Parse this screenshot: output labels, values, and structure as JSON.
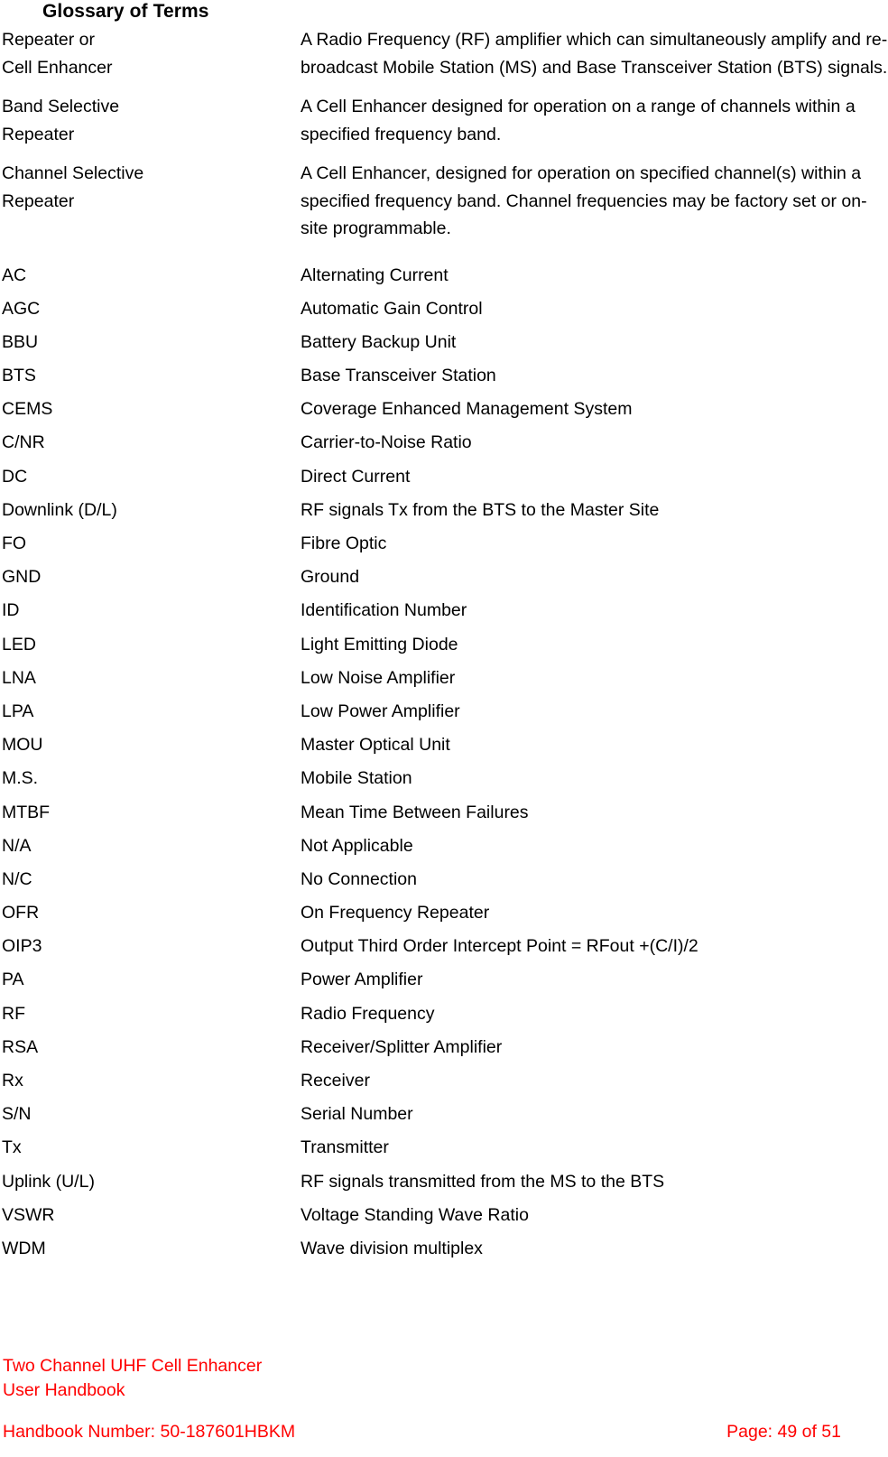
{
  "document": {
    "heading": "Glossary of Terms",
    "accent_color": "#ff0000",
    "text_color": "#000000",
    "background_color": "#ffffff"
  },
  "glossary": {
    "paragraph_entries": [
      {
        "term": "Repeater or\nCell Enhancer",
        "definition": "A Radio Frequency (RF) amplifier which can simultaneously amplify and re-broadcast Mobile Station (MS) and Base Transceiver Station (BTS) signals."
      },
      {
        "term": "Band Selective\nRepeater",
        "definition": "A Cell Enhancer designed for operation on a range of channels within a specified frequency band."
      },
      {
        "term": "Channel Selective\nRepeater",
        "definition": "A Cell Enhancer, designed for operation on specified channel(s) within a specified frequency band. Channel frequencies may be factory set or on-site programmable."
      }
    ],
    "acronym_entries": [
      {
        "term": "AC",
        "definition": "Alternating Current"
      },
      {
        "term": "AGC",
        "definition": "Automatic Gain Control"
      },
      {
        "term": "BBU",
        "definition": "Battery Backup Unit"
      },
      {
        "term": "BTS",
        "definition": "Base Transceiver Station"
      },
      {
        "term": "CEMS",
        "definition": "Coverage Enhanced Management System"
      },
      {
        "term": "C/NR",
        "definition": "Carrier-to-Noise Ratio"
      },
      {
        "term": "DC",
        "definition": "Direct Current"
      },
      {
        "term": "Downlink (D/L)",
        "definition": "RF signals Tx from the BTS to the Master Site"
      },
      {
        "term": "FO",
        "definition": "Fibre Optic"
      },
      {
        "term": "GND",
        "definition": "Ground"
      },
      {
        "term": "ID",
        "definition": "Identification Number"
      },
      {
        "term": "LED",
        "definition": "Light Emitting Diode"
      },
      {
        "term": "LNA",
        "definition": "Low Noise Amplifier"
      },
      {
        "term": "LPA",
        "definition": "Low Power Amplifier"
      },
      {
        "term": "MOU",
        "definition": "Master Optical Unit"
      },
      {
        "term": "M.S.",
        "definition": "Mobile Station"
      },
      {
        "term": "MTBF",
        "definition": "Mean Time Between Failures"
      },
      {
        "term": "N/A",
        "definition": "Not Applicable"
      },
      {
        "term": "N/C",
        "definition": "No Connection"
      },
      {
        "term": "OFR",
        "definition": "On Frequency Repeater"
      },
      {
        "term": "OIP3",
        "definition": "Output Third Order Intercept Point = RFout +(C/I)/2"
      },
      {
        "term": "PA",
        "definition": "Power Amplifier"
      },
      {
        "term": "RF",
        "definition": "Radio Frequency"
      },
      {
        "term": "RSA",
        "definition": "Receiver/Splitter Amplifier"
      },
      {
        "term": "Rx",
        "definition": "Receiver"
      },
      {
        "term": "S/N",
        "definition": "Serial Number"
      },
      {
        "term": "Tx",
        "definition": "Transmitter"
      },
      {
        "term": "Uplink (U/L)",
        "definition": "RF signals transmitted from the MS to the BTS"
      },
      {
        "term": "VSWR",
        "definition": "Voltage Standing Wave Ratio"
      },
      {
        "term": "WDM",
        "definition": "Wave division multiplex"
      }
    ]
  },
  "footer": {
    "product_title": "Two Channel UHF Cell Enhancer",
    "document_type": "User Handbook",
    "handbook_number": "Handbook Number: 50-187601HBKM",
    "page_label": "Page: 49 of 51"
  }
}
